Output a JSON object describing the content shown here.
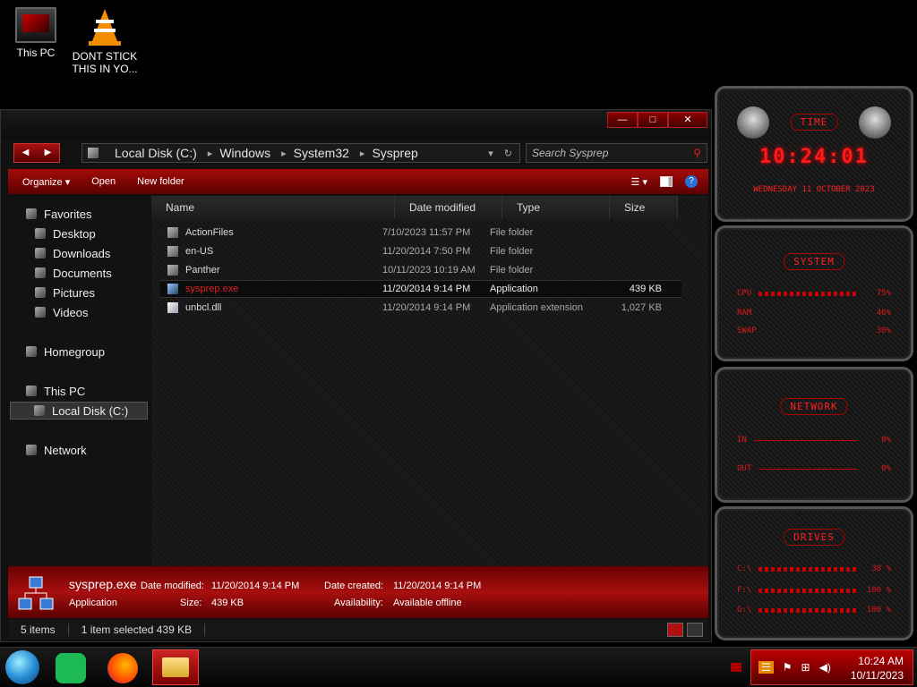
{
  "desktop": {
    "icons": [
      {
        "label": "This PC"
      },
      {
        "label": "DONT STICK THIS IN YO..."
      }
    ]
  },
  "window": {
    "buttons": {
      "minimize": "—",
      "maximize": "□",
      "close": "✕"
    },
    "nav": {
      "back": "◀",
      "forward": "▶"
    },
    "breadcrumb": [
      "Local Disk (C:)",
      "Windows",
      "System32",
      "Sysprep"
    ],
    "search_placeholder": "Search Sysprep",
    "commands": {
      "organize": "Organize ▾",
      "open": "Open",
      "new_folder": "New folder",
      "help": "?"
    },
    "nav_pane": {
      "favorites": "Favorites",
      "desktop": "Desktop",
      "downloads": "Downloads",
      "documents": "Documents",
      "pictures": "Pictures",
      "videos": "Videos",
      "homegroup": "Homegroup",
      "this_pc": "This PC",
      "local_disk": "Local Disk (C:)",
      "network": "Network"
    },
    "columns": {
      "name": "Name",
      "date": "Date modified",
      "type": "Type",
      "size": "Size"
    },
    "files": [
      {
        "name": "ActionFiles",
        "date": "7/10/2023 11:57 PM",
        "type": "File folder",
        "size": ""
      },
      {
        "name": "en-US",
        "date": "11/20/2014 7:50 PM",
        "type": "File folder",
        "size": ""
      },
      {
        "name": "Panther",
        "date": "10/11/2023 10:19 AM",
        "type": "File folder",
        "size": ""
      },
      {
        "name": "sysprep.exe",
        "date": "11/20/2014 9:14 PM",
        "type": "Application",
        "size": "439 KB"
      },
      {
        "name": "unbcl.dll",
        "date": "11/20/2014 9:14 PM",
        "type": "Application extension",
        "size": "1,027 KB"
      }
    ],
    "details": {
      "filename": "sysprep.exe",
      "date_modified_label": "Date modified:",
      "date_modified": "11/20/2014 9:14 PM",
      "date_created_label": "Date created:",
      "date_created": "11/20/2014 9:14 PM",
      "kind": "Application",
      "size_label": "Size:",
      "size": "439 KB",
      "availability_label": "Availability:",
      "availability": "Available offline"
    },
    "status": {
      "items": "5 items",
      "selected": "1 item selected  439 KB"
    }
  },
  "widgets": {
    "time": {
      "title": "TIME",
      "clock": "10:24:01",
      "date": "WEDNESDAY 11 OCTOBER 2023"
    },
    "system": {
      "title": "SYSTEM",
      "rows": [
        {
          "label": "CPU",
          "value": "75%"
        },
        {
          "label": "RAM",
          "value": "46%"
        },
        {
          "label": "SWAP",
          "value": "30%"
        }
      ]
    },
    "network": {
      "title": "NETWORK",
      "rows": [
        {
          "label": "IN",
          "value": "0%"
        },
        {
          "label": "OUT",
          "value": "0%"
        }
      ]
    },
    "drives": {
      "title": "DRIVES",
      "rows": [
        {
          "label": "C:\\",
          "value": "38 %"
        },
        {
          "label": "F:\\",
          "value": "100 %"
        },
        {
          "label": "G:\\",
          "value": "100 %"
        }
      ]
    }
  },
  "taskbar": {
    "time": "10:24 AM",
    "date": "10/11/2023"
  },
  "colors": {
    "accent": "#b00000",
    "text_red": "#e02020"
  }
}
